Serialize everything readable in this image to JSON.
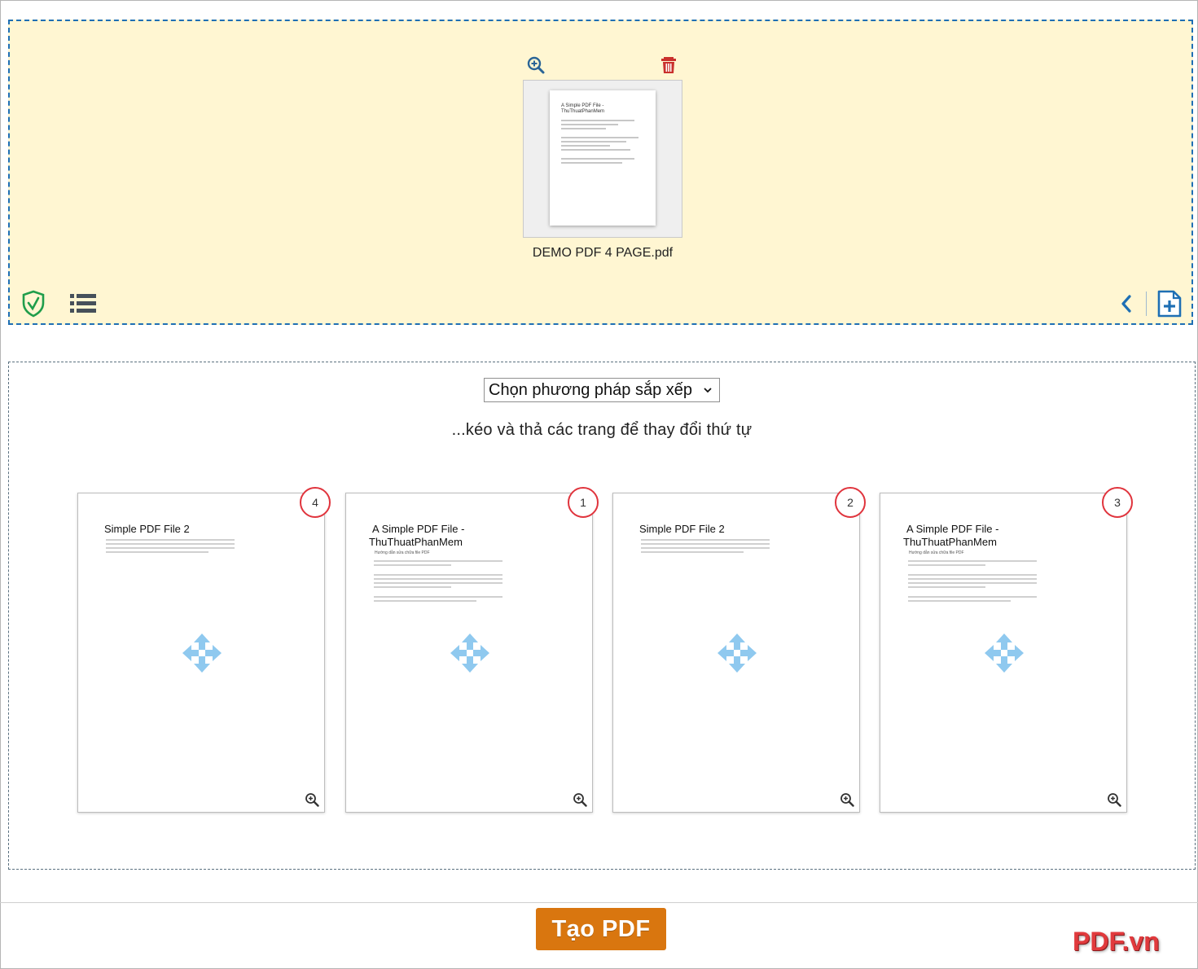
{
  "upload": {
    "file_name": "DEMO PDF 4 PAGE.pdf",
    "thumb_title": "A Simple PDF File - ThuThuatPhanMem"
  },
  "pages_section": {
    "sort_label": "Chọn phương pháp sắp xếp",
    "hint": "...kéo và thả các trang để thay đổi thứ tự",
    "pages": [
      {
        "number": "4",
        "title_line1": "Simple PDF File 2",
        "title_line2": "",
        "subtitle": "",
        "text_lines": 4
      },
      {
        "number": "1",
        "title_line1": "A Simple PDF File -",
        "title_line2": "ThuThuatPhanMem",
        "subtitle": "Hướng dẫn sửa chữa file PDF",
        "text_lines": 9
      },
      {
        "number": "2",
        "title_line1": "Simple PDF File 2",
        "title_line2": "",
        "subtitle": "",
        "text_lines": 4
      },
      {
        "number": "3",
        "title_line1": "A Simple PDF File -",
        "title_line2": "ThuThuatPhanMem",
        "subtitle": "Hướng dẫn sửa chữa file PDF",
        "text_lines": 9
      }
    ]
  },
  "footer": {
    "create_button": "Tạo PDF",
    "brand": "PDF.vn"
  },
  "colors": {
    "upload_bg": "#fff6d2",
    "upload_border": "#1e6fb4",
    "page_number_ring": "#e0343d",
    "button": "#d9760f",
    "brand": "#e13a3d",
    "move_icon": "#8fc9ef"
  }
}
